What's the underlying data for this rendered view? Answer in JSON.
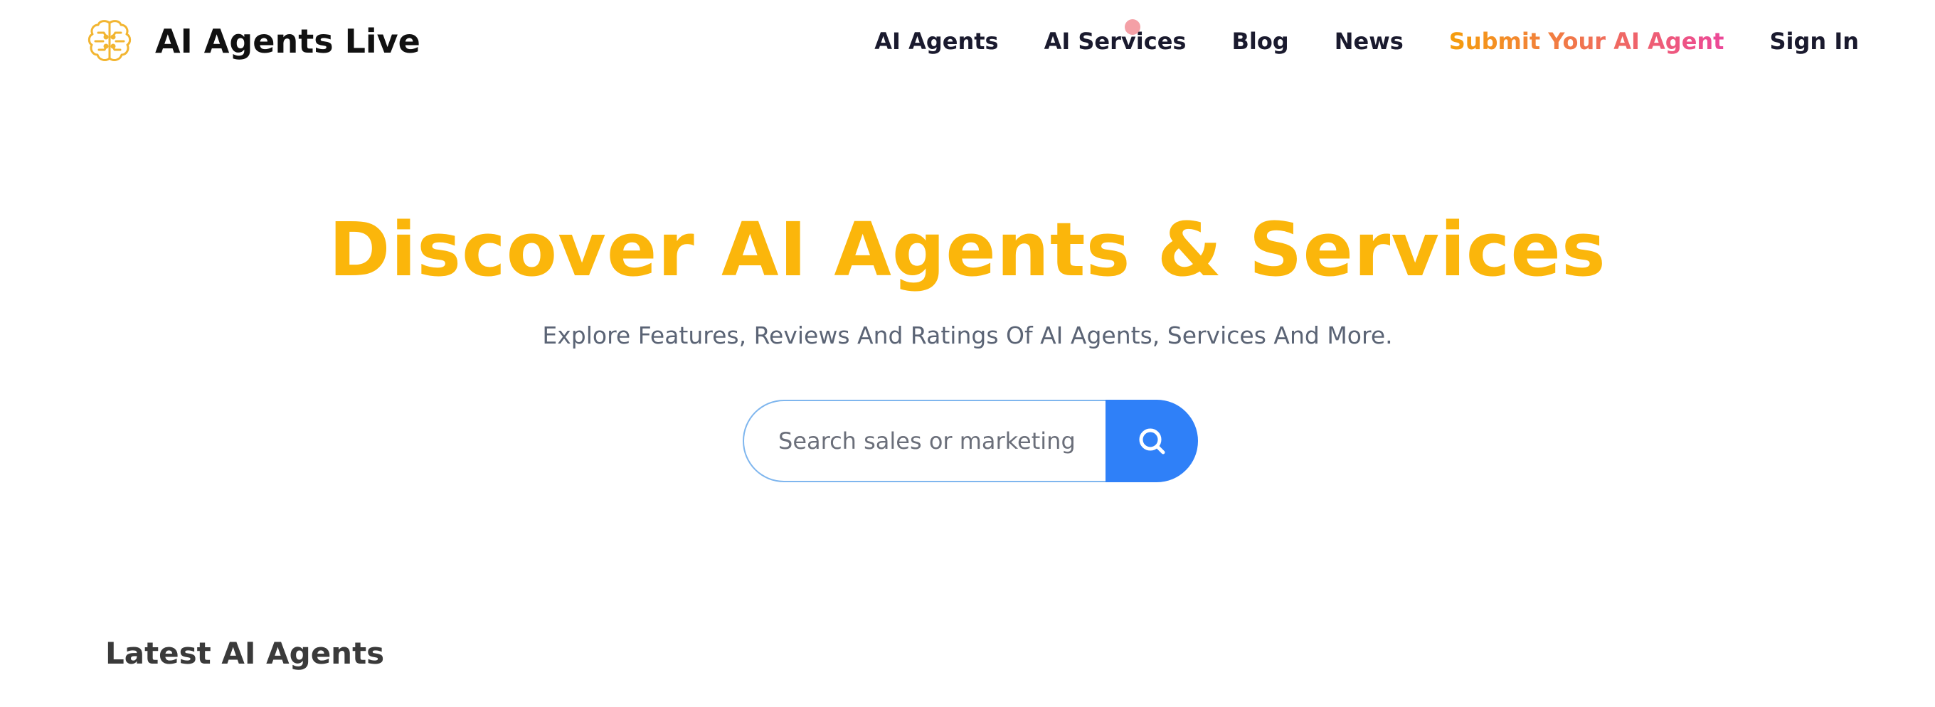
{
  "brand": {
    "name": "AI Agents Live",
    "logo_icon": "brain-icon",
    "logo_color": "#f2b531"
  },
  "nav": {
    "items": [
      {
        "label": "AI Agents"
      },
      {
        "label": "AI Services"
      },
      {
        "label": "Blog"
      },
      {
        "label": "News"
      },
      {
        "label": "Submit Your AI Agent"
      },
      {
        "label": "Sign In"
      }
    ],
    "highlight_gradient": [
      "#f59e0b",
      "#ec4899"
    ]
  },
  "hero": {
    "title": "Discover AI Agents & Services",
    "title_color": "#fbb60b",
    "subtitle": "Explore Features, Reviews And Ratings Of AI Agents, Services And More."
  },
  "search": {
    "placeholder": "Search sales or marketing",
    "value": "",
    "button_icon": "search-icon",
    "button_color": "#2f80f8"
  },
  "sections": {
    "latest_title": "Latest AI Agents"
  },
  "colors": {
    "cursor_dot": "#f4a0a6"
  }
}
